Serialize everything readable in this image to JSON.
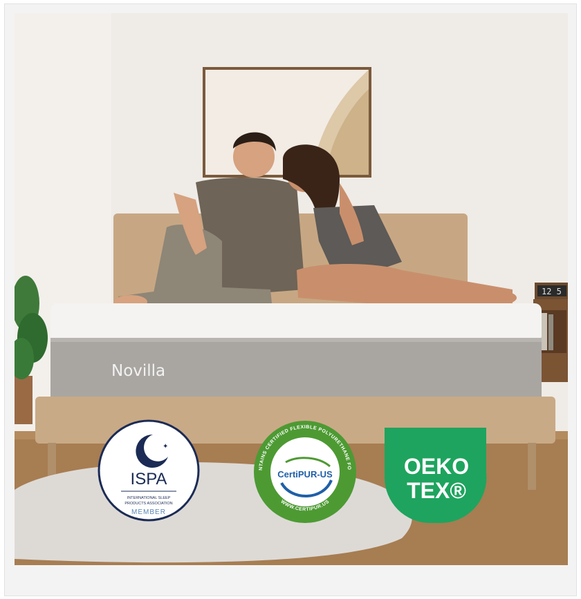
{
  "product_image": {
    "alt": "",
    "brand_label": "Novilla",
    "clock_text": "12 5",
    "badges": {
      "ispa": {
        "title": "ISPA",
        "subtitle_line1": "INTERNATIONAL SLEEP",
        "subtitle_line2": "PRODUCTS ASSOCIATION",
        "member": "MEMBER"
      },
      "certipur": {
        "center": "CertiPUR-US",
        "ring_top": "CONTAINS CERTIFIED FLEXIBLE POLYURETHANE FOAM",
        "ring_bottom": "WWW.CERTIPUR.US"
      },
      "oekotex": {
        "line1": "OEKO",
        "line2": "TEX®"
      }
    }
  },
  "colors": {
    "wall": "#efebe6",
    "floor": "#a77d52",
    "bed_frame": "#c9aa86",
    "mattress_top": "#f4f3f1",
    "mattress_side": "#a9a6a2",
    "certipur_green": "#4d9a33",
    "certipur_blue": "#1f5fa8",
    "oekotex_green": "#1ea45e",
    "ispa_navy": "#1b2b55"
  }
}
